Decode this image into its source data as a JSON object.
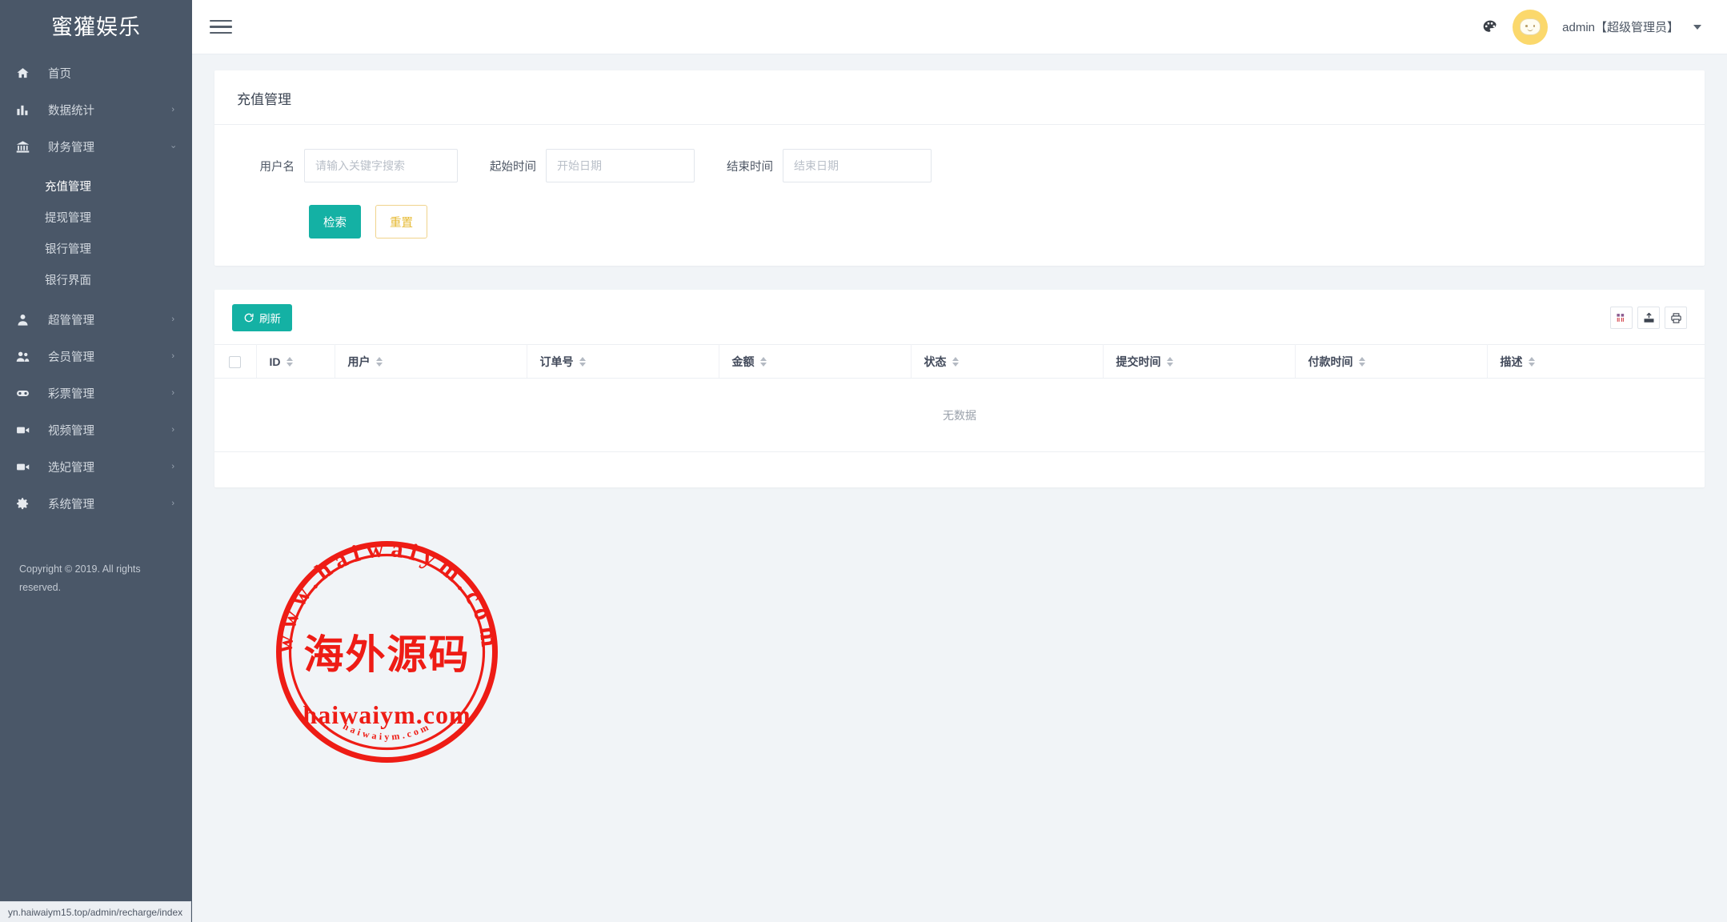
{
  "sidebar": {
    "logo": "蜜獾娱乐",
    "copyright": "Copyright © 2019. All rights reserved.",
    "items": [
      {
        "label": "首页",
        "icon": "home-icon",
        "arrow": ""
      },
      {
        "label": "数据统计",
        "icon": "bar-chart-icon",
        "arrow": "›"
      },
      {
        "label": "财务管理",
        "icon": "bank-icon",
        "arrow": "›"
      },
      {
        "label": "超管管理",
        "icon": "user-icon",
        "arrow": "›"
      },
      {
        "label": "会员管理",
        "icon": "users-icon",
        "arrow": "›"
      },
      {
        "label": "彩票管理",
        "icon": "gamepad-icon",
        "arrow": "›"
      },
      {
        "label": "视频管理",
        "icon": "video-icon",
        "arrow": "›"
      },
      {
        "label": "选妃管理",
        "icon": "video-icon",
        "arrow": "›"
      },
      {
        "label": "系统管理",
        "icon": "gear-icon",
        "arrow": "›"
      }
    ],
    "finance_sub_items": [
      {
        "label": "充值管理"
      },
      {
        "label": "提现管理"
      },
      {
        "label": "银行管理"
      },
      {
        "label": "银行界面"
      }
    ]
  },
  "topbar": {
    "menu_toggle_icon": "hamburger-icon",
    "palette_icon": "palette-icon",
    "avatar_icon": "avatar",
    "user_name": "admin【超级管理员】",
    "caret_icon": "caret-down-icon"
  },
  "search_panel": {
    "title": "充值管理",
    "fields": [
      {
        "label": "用户名",
        "value": "",
        "placeholder": "请输入关键字搜索"
      },
      {
        "label": "起始时间",
        "value": "",
        "placeholder": "开始日期"
      },
      {
        "label": "结束时间",
        "value": "",
        "placeholder": "结束日期"
      }
    ],
    "search_button": "检索",
    "reset_button": "重置"
  },
  "table_panel": {
    "refresh_button": "刷新",
    "refresh_icon": "refresh-icon",
    "tool_icons": [
      {
        "name": "columns-icon"
      },
      {
        "name": "export-icon"
      },
      {
        "name": "print-icon"
      }
    ],
    "columns": [
      {
        "label": "",
        "sortable": false
      },
      {
        "label": "ID",
        "sortable": true
      },
      {
        "label": "用户",
        "sortable": true
      },
      {
        "label": "订单号",
        "sortable": true
      },
      {
        "label": "金额",
        "sortable": true
      },
      {
        "label": "状态",
        "sortable": true
      },
      {
        "label": "提交时间",
        "sortable": true
      },
      {
        "label": "付款时间",
        "sortable": true
      },
      {
        "label": "描述",
        "sortable": true
      }
    ],
    "rows": [],
    "empty_text": "无数据"
  },
  "watermark": {
    "arc_text": "www.haiwaiym.com",
    "center_text": "海外源码",
    "bottom_text": "haiwaiym.com",
    "small_arc_text": "haiwaiym.com",
    "color": "#ee1c15"
  },
  "statusbar": {
    "url": "yn.haiwaiym15.top/admin/recharge/index"
  },
  "colors": {
    "sidebar_bg": "#4a5768",
    "accent_teal": "#14b1a4",
    "accent_yellow": "#e6b931",
    "page_bg": "#f1f4f7"
  }
}
